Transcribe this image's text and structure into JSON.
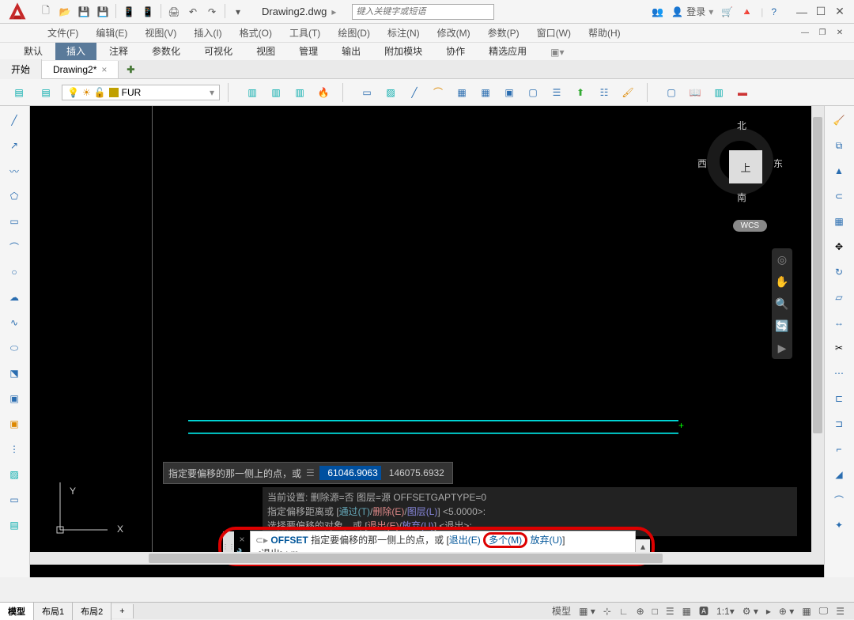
{
  "title": {
    "filename": "Drawing2.dwg",
    "search_placeholder": "键入关键字或短语",
    "login": "登录"
  },
  "menu": [
    "文件(F)",
    "编辑(E)",
    "视图(V)",
    "插入(I)",
    "格式(O)",
    "工具(T)",
    "绘图(D)",
    "标注(N)",
    "修改(M)",
    "参数(P)",
    "窗口(W)",
    "帮助(H)"
  ],
  "ribbon_tabs": [
    "默认",
    "插入",
    "注释",
    "参数化",
    "可视化",
    "视图",
    "管理",
    "输出",
    "附加模块",
    "协作",
    "精选应用"
  ],
  "ribbon_active": 1,
  "doc_tabs": {
    "start": "开始",
    "current": "Drawing2*"
  },
  "layer": {
    "name": "FUR"
  },
  "tooltip": {
    "prompt": "指定要偏移的那一侧上的点，或",
    "value1": "61046.9063",
    "value2": "146075.6932"
  },
  "history": {
    "l1_a": "当前设置: 删除源=否   图层=源   OFFSETGAPTYPE=0",
    "l2_a": "指定偏移距离或 [",
    "l2_t": "通过(T)",
    "l2_s1": "/",
    "l2_e": "删除(E)",
    "l2_s2": "/",
    "l2_l": "图层(L)",
    "l2_b": "] <5.0000>:",
    "l3_a": "选择要偏移的对象，或 [",
    "l3_e": "退出(E)",
    "l3_s": "/",
    "l3_u": "放弃(U)",
    "l3_b": "] <退出>:"
  },
  "cmd": {
    "name": "OFFSET",
    "prompt": "指定要偏移的那一侧上的点，或 [",
    "opt_e": "退出(E)",
    "opt_m": "多个(M)",
    "opt_u": "放弃(U)",
    "close": "]",
    "line2": "<退出>:   m"
  },
  "viewcube": {
    "top": "上",
    "n": "北",
    "s": "南",
    "e": "东",
    "w": "西",
    "wcs": "WCS"
  },
  "ucs": {
    "x": "X",
    "y": "Y"
  },
  "bottom_tabs": [
    "模型",
    "布局1",
    "布局2"
  ],
  "status": {
    "model": "模型",
    "scale": "1:1"
  }
}
